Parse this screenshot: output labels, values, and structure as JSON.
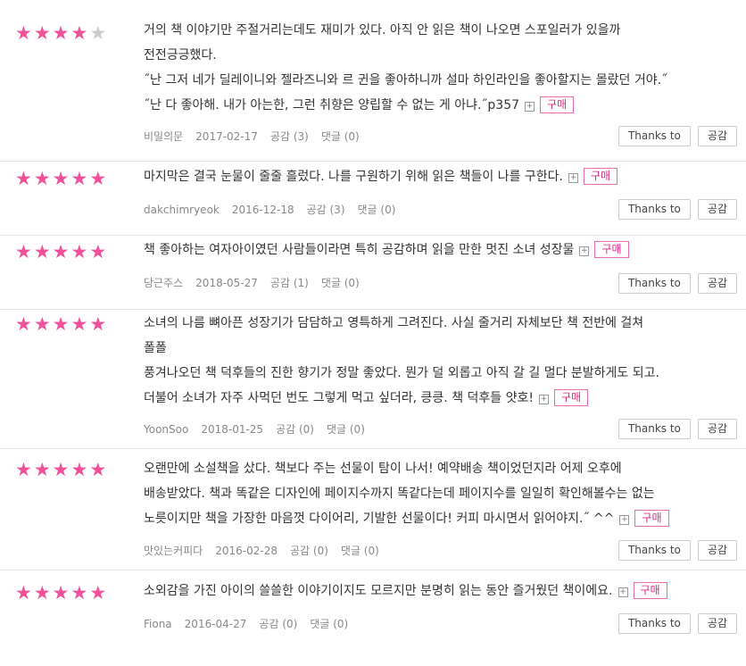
{
  "reviews": [
    {
      "rating": 4,
      "lines": [
        "거의 책 이야기만 주절거리는데도 재미가 있다. 아직 안 읽은 책이 나오면 스포일러가 있을까",
        "전전긍긍했다.",
        "˝난 그저 네가 딜레이니와 젤라즈니와 르 귄을 좋아하니까 설마 하인라인을 좋아할지는 몰랐던 거야.˝",
        "˝난 다 좋아해. 내가 아는한, 그런 취향은 양립할 수 없는 게 아냐.˝p357"
      ],
      "user": "비밀의문",
      "date": "2017-02-17",
      "likes": "공감 (3)",
      "comments": "댓글 (0)"
    },
    {
      "rating": 5,
      "lines": [
        "마지막은 결국 눈물이 줄줄 흘렀다. 나를 구원하기 위해 읽은 책들이 나를 구한다."
      ],
      "user": "dakchimryeok",
      "date": "2016-12-18",
      "likes": "공감 (3)",
      "comments": "댓글 (0)"
    },
    {
      "rating": 5,
      "lines": [
        "책 좋아하는 여자아이였던 사람들이라면 특히 공감하며 읽을 만한 멋진 소녀 성장물"
      ],
      "user": "당근주스",
      "date": "2018-05-27",
      "likes": "공감 (1)",
      "comments": "댓글 (0)"
    },
    {
      "rating": 5,
      "lines": [
        "소녀의 나름 뼈아픈 성장기가 담담하고 영특하게 그려진다. 사실 줄거리 자체보단 책 전반에 걸쳐",
        "폴폴",
        "풍겨나오던 책 덕후들의 진한 향기가 정말 좋았다. 뭔가 덜 외롭고 아직 갈 길 멀다 분발하게도 되고.",
        "더불어 소녀가 자주 사먹던 번도 그렇게 먹고 싶더라, 킁킁. 책 덕후들 얏호!"
      ],
      "user": "YoonSoo",
      "date": "2018-01-25",
      "likes": "공감 (0)",
      "comments": "댓글 (0)"
    },
    {
      "rating": 5,
      "lines": [
        "오랜만에 소설책을 샀다. 책보다 주는 선물이 탐이 나서! 예약배송 책이었던지라 어제 오후에",
        "배송받았다. 책과 똑같은 디자인에 페이지수까지 똑같다는데 페이지수를 일일히 확인해볼수는 없는",
        "노릇이지만 책을 가장한 마음껏 다이어리, 기발한 선물이다! 커피 마시면서 읽어야지.˝ ^^"
      ],
      "user": "맛있는커피다",
      "date": "2016-02-28",
      "likes": "공감 (0)",
      "comments": "댓글 (0)"
    },
    {
      "rating": 5,
      "lines": [
        "소외감을 가진 아이의 쓸쓸한 이야기이지도 모르지만 분명히 읽는 동안 즐거웠던 책이에요."
      ],
      "user": "Fiona",
      "date": "2016-04-27",
      "likes": "공감 (0)",
      "comments": "댓글 (0)"
    }
  ],
  "labels": {
    "buy": "구매",
    "thanks": "Thanks to",
    "empathy": "공감",
    "expand": "+"
  },
  "colors": {
    "star_on": "#f05199",
    "star_off": "#cccccc",
    "buy_border": "#e46fa7"
  }
}
